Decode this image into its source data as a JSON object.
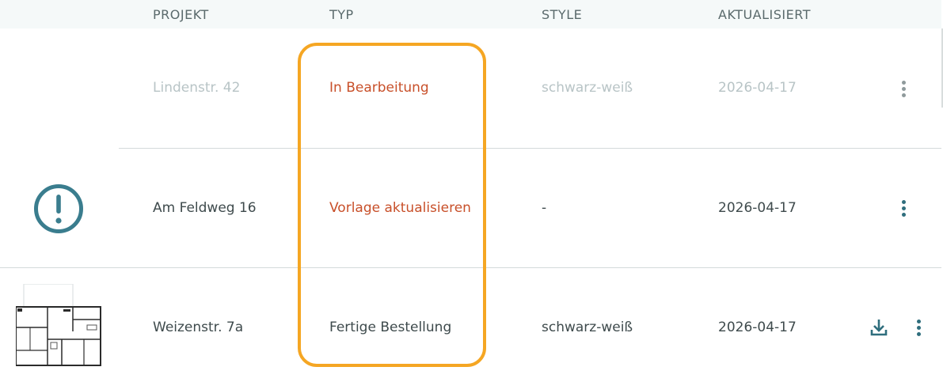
{
  "table": {
    "columns": [
      "PROJEKT",
      "TYP",
      "STYLE",
      "AKTUALISIERT"
    ],
    "rows": [
      {
        "projekt": "Lindenstr. 42",
        "typ": "In Bearbeitung",
        "style": "schwarz-weiß",
        "aktualisiert": "2026-04-17",
        "faded": true,
        "icon": "none"
      },
      {
        "projekt": "Am Feldweg 16",
        "typ": "Vorlage aktualisieren",
        "style": "-",
        "aktualisiert": "2026-04-17",
        "faded": false,
        "icon": "exclamation-circle-icon"
      },
      {
        "projekt": "Weizenstr. 7a",
        "typ": "Fertige Bestellung",
        "style": "schwarz-weiß",
        "aktualisiert": "2026-04-17",
        "faded": false,
        "icon": "floorplan-thumbnail"
      }
    ]
  },
  "colors": {
    "accent_teal": "#2f6e7d",
    "status_orange": "#c8502a",
    "highlight": "#f5a623",
    "header_bg": "#f5f9f9"
  }
}
